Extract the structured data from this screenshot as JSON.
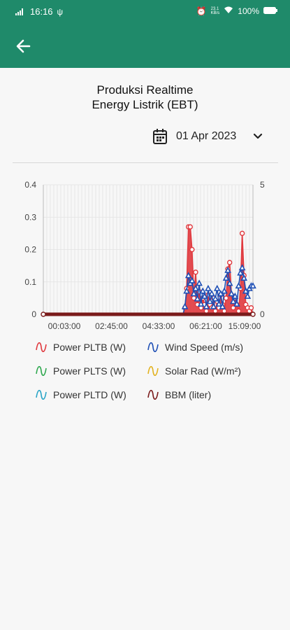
{
  "status": {
    "time": "16:16",
    "battery": "100%",
    "net_top": "23.1",
    "net_bottom": "KB/s"
  },
  "header": {
    "back_icon": "arrow-left-icon"
  },
  "page": {
    "title_line1": "Produksi Realtime",
    "title_line2": "Energy Listrik (EBT)"
  },
  "date_picker": {
    "value": "01 Apr 2023",
    "icon": "calendar-icon",
    "dropdown_icon": "chevron-down-icon"
  },
  "colors": {
    "brand": "#1f8a6a",
    "pltb": "#e0393e",
    "wind": "#1e4fb5",
    "plts": "#2fa84f",
    "solar": "#e2b21e",
    "pltd": "#29a5c7",
    "bbm": "#7a1b1b"
  },
  "chart_data": {
    "type": "line",
    "y_left": {
      "ticks": [
        "0",
        "0.1",
        "0.2",
        "0.3",
        "0.4"
      ],
      "range": [
        0,
        0.4
      ]
    },
    "y_right": {
      "ticks": [
        "0",
        "5"
      ],
      "range": [
        0,
        5
      ]
    },
    "x_ticks": [
      "00:03:00",
      "02:45:00",
      "04:33:00",
      "06:21:00",
      "15:09:00"
    ],
    "grid": true,
    "legend_position": "bottom",
    "series": [
      {
        "name": "Power PLTB (W)",
        "axis": "left",
        "color": "#e0393e",
        "values": [
          0,
          0,
          0,
          0,
          0,
          0,
          0,
          0,
          0,
          0,
          0,
          0,
          0,
          0,
          0,
          0,
          0,
          0,
          0,
          0,
          0,
          0,
          0,
          0,
          0,
          0,
          0,
          0,
          0,
          0,
          0,
          0,
          0,
          0,
          0,
          0,
          0,
          0,
          0,
          0,
          0,
          0,
          0,
          0,
          0,
          0,
          0,
          0,
          0,
          0,
          0,
          0,
          0,
          0,
          0,
          0,
          0,
          0,
          0,
          0,
          0,
          0,
          0,
          0,
          0,
          0,
          0,
          0,
          0,
          0,
          0,
          0,
          0,
          0,
          0,
          0,
          0,
          0,
          0,
          0.02,
          0.08,
          0.27,
          0.27,
          0.2,
          0.05,
          0.13,
          0.03,
          0.07,
          0.02,
          0.05,
          0.03,
          0.01,
          0.06,
          0.03,
          0.02,
          0.05,
          0.01,
          0.04,
          0.02,
          0.06,
          0.03,
          0.01,
          0.05,
          0.14,
          0.16,
          0.06,
          0.02,
          0.05,
          0.03,
          0.01,
          0.08,
          0.25,
          0.12,
          0.03,
          0.02,
          0.01,
          0.02,
          0
        ]
      },
      {
        "name": "Wind Speed (m/s)",
        "axis": "right",
        "color": "#1e4fb5",
        "values": [
          0,
          0,
          0,
          0,
          0,
          0,
          0,
          0,
          0,
          0,
          0,
          0,
          0,
          0,
          0,
          0,
          0,
          0,
          0,
          0,
          0,
          0,
          0,
          0,
          0,
          0,
          0,
          0,
          0,
          0,
          0,
          0,
          0,
          0,
          0,
          0,
          0,
          0,
          0,
          0,
          0,
          0,
          0,
          0,
          0,
          0,
          0,
          0,
          0,
          0,
          0,
          0,
          0,
          0,
          0,
          0,
          0,
          0,
          0,
          0,
          0,
          0,
          0,
          0,
          0,
          0,
          0,
          0,
          0,
          0,
          0,
          0,
          0,
          0,
          0,
          0,
          0,
          0,
          0,
          0.3,
          0.9,
          1.5,
          1.2,
          1.3,
          0.8,
          1.0,
          0.6,
          1.2,
          0.4,
          0.9,
          0.7,
          0.3,
          1.0,
          0.5,
          0.8,
          0.3,
          0.6,
          1.0,
          0.4,
          0.8,
          0.3,
          0.9,
          1.4,
          1.7,
          1.2,
          0.8,
          0.5,
          0.7,
          0.4,
          1.1,
          1.6,
          1.8,
          1.4,
          0.9,
          0.7,
          1.0,
          1.1,
          1.1
        ]
      },
      {
        "name": "Power PLTS (W)",
        "axis": "left",
        "color": "#2fa84f",
        "values": [
          0
        ]
      },
      {
        "name": "Solar Rad (W/m²)",
        "axis": "right",
        "color": "#e2b21e",
        "values": [
          0
        ]
      },
      {
        "name": "Power PLTD (W)",
        "axis": "left",
        "color": "#29a5c7",
        "values": [
          0
        ]
      },
      {
        "name": "BBM (liter)",
        "axis": "left",
        "color": "#7a1b1b",
        "values": [
          0
        ]
      }
    ]
  }
}
